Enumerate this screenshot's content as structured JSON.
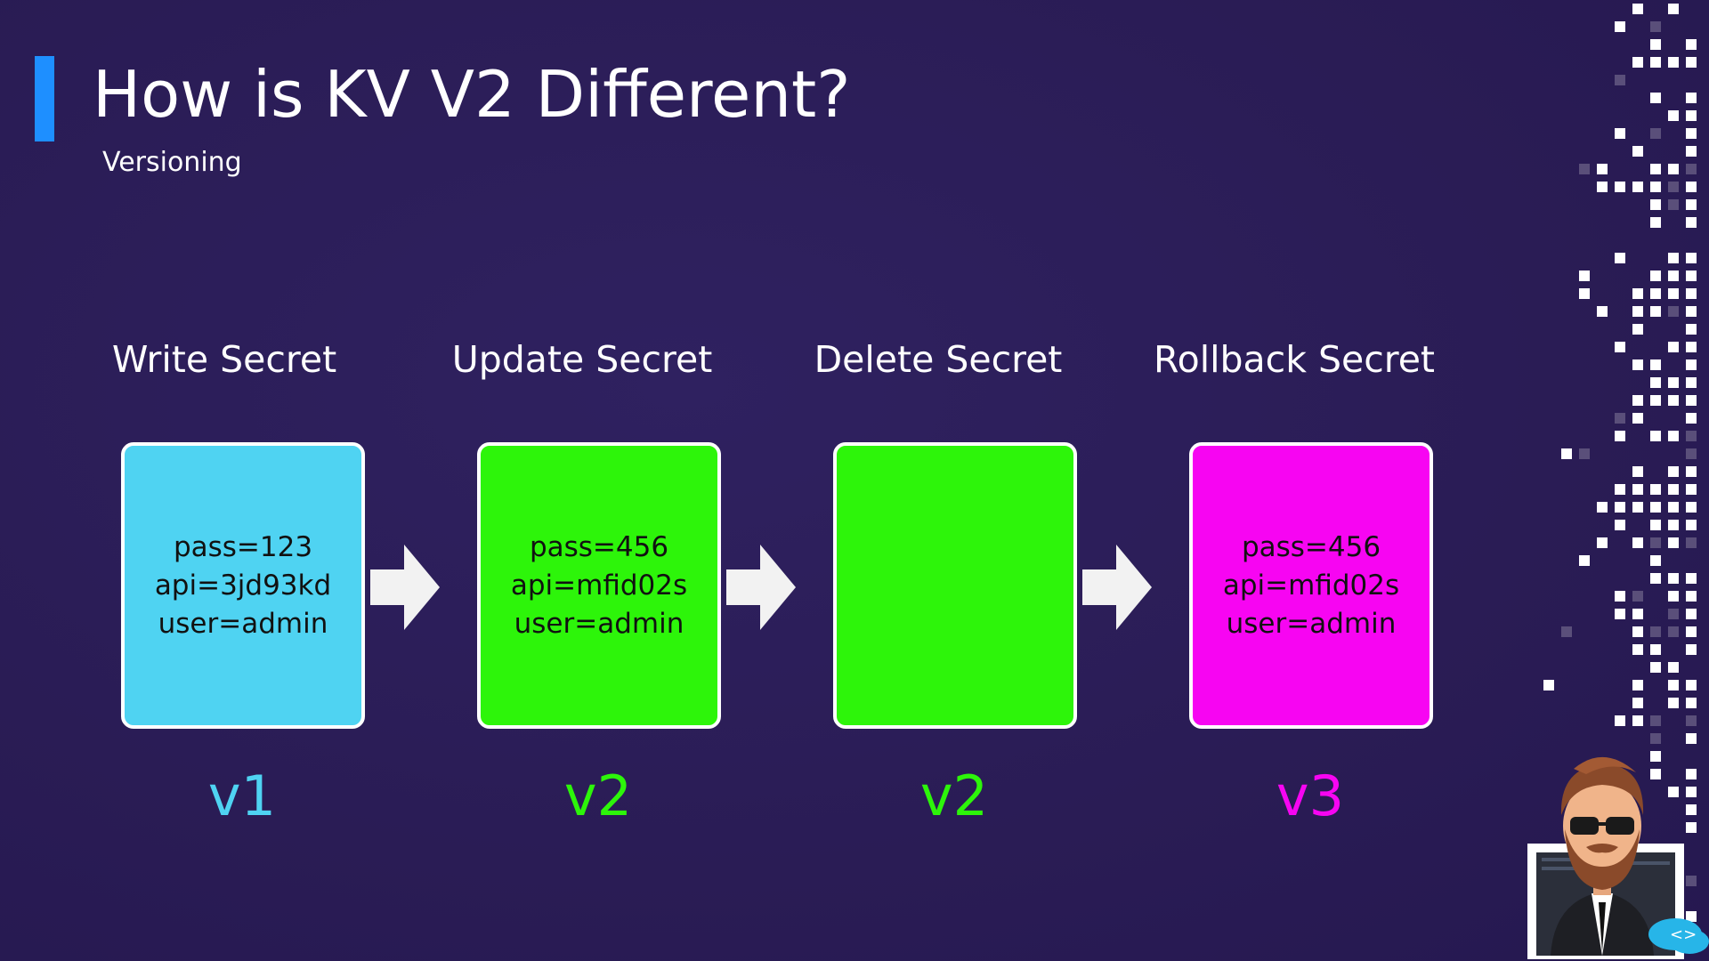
{
  "title": "How is KV V2 Different?",
  "subtitle": "Versioning",
  "colors": {
    "accent": "#1e8fff",
    "v1": "#4fd3f2",
    "v2": "#2df50a",
    "v3": "#f705f2"
  },
  "steps": [
    {
      "label": "Write Secret",
      "lines": [
        "pass=123",
        "api=3jd93kd",
        "user=admin"
      ],
      "version": "v1"
    },
    {
      "label": "Update Secret",
      "lines": [
        "pass=456",
        "api=mfid02s",
        "user=admin"
      ],
      "version": "v2"
    },
    {
      "label": "Delete Secret",
      "lines": [
        "",
        "",
        ""
      ],
      "version": "v2"
    },
    {
      "label": "Rollback Secret",
      "lines": [
        "pass=456",
        "api=mfid02s",
        "user=admin"
      ],
      "version": "v3"
    }
  ]
}
